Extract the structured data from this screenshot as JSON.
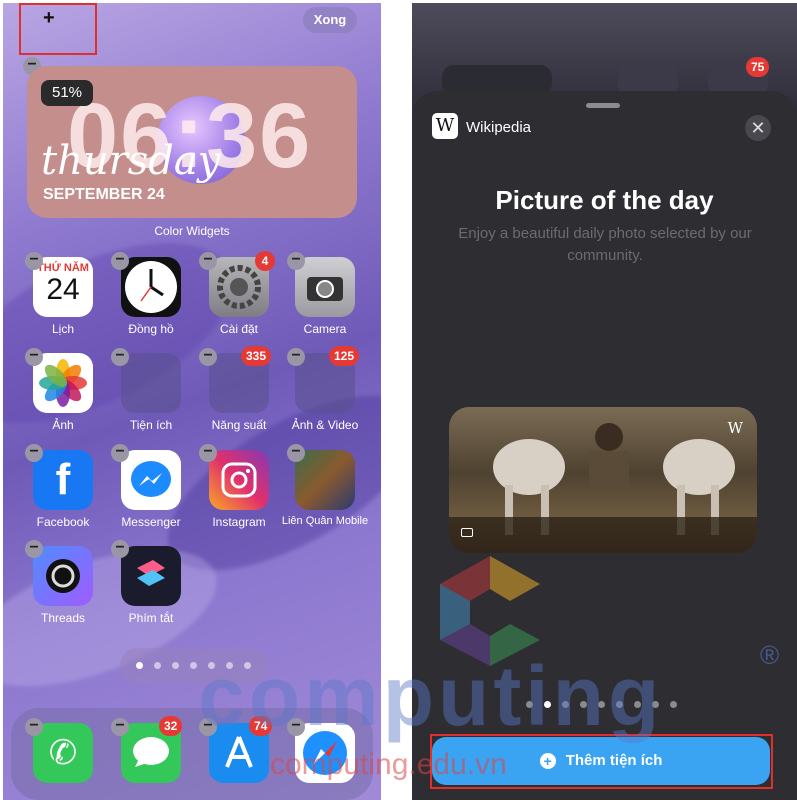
{
  "left": {
    "top_bar": {
      "add_symbol": "+",
      "done_label": "Xong"
    },
    "widget": {
      "battery": "51%",
      "time": "06:36",
      "day": "thursday",
      "date": "SEPTEMBER 24",
      "name": "Color Widgets"
    },
    "apps_row1": [
      {
        "label": "Lịch",
        "icon": "calendar-icon",
        "cal_month": "THỨ NĂM",
        "cal_day": "24"
      },
      {
        "label": "Đồng hồ",
        "icon": "clock-icon"
      },
      {
        "label": "Cài đặt",
        "icon": "settings-icon",
        "badge": "4"
      },
      {
        "label": "Camera",
        "icon": "camera-icon"
      }
    ],
    "apps_row2": [
      {
        "label": "Ảnh",
        "icon": "photos-icon"
      },
      {
        "label": "Tiện ích",
        "icon": "folder-icon"
      },
      {
        "label": "Năng suất",
        "icon": "folder-icon",
        "badge": "335"
      },
      {
        "label": "Ảnh & Video",
        "icon": "folder-icon",
        "badge": "125"
      }
    ],
    "apps_row3": [
      {
        "label": "Facebook",
        "icon": "facebook-icon"
      },
      {
        "label": "Messenger",
        "icon": "messenger-icon"
      },
      {
        "label": "Instagram",
        "icon": "instagram-icon"
      },
      {
        "label": "Liên Quân Mobile",
        "icon": "game-icon"
      }
    ],
    "apps_row4": [
      {
        "label": "Threads",
        "icon": "threads-icon"
      },
      {
        "label": "Phím tắt",
        "icon": "shortcuts-icon"
      }
    ],
    "dock": [
      {
        "icon": "phone-icon"
      },
      {
        "icon": "messages-icon",
        "badge": "32"
      },
      {
        "icon": "app-store-icon",
        "badge": "74"
      },
      {
        "icon": "safari-icon"
      }
    ]
  },
  "right": {
    "bg_badge": "75",
    "widget_app": "Wikipedia",
    "wiki_logo": "W",
    "close": "✕",
    "title": "Picture of the day",
    "description": "Enjoy a beautiful daily photo selected by our community.",
    "photo_logo": "W",
    "add_button": "Thêm tiện ích"
  },
  "watermark": {
    "brand": "computing",
    "site": "computing.edu.vn",
    "reg": "®"
  },
  "colors": {
    "badge_red": "#e53935",
    "add_button_blue": "#3aa3f2",
    "highlight_red": "#e0302e"
  }
}
